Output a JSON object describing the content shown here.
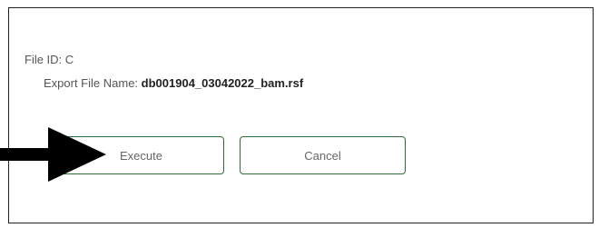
{
  "dialog": {
    "file_id": "File ID: C",
    "export_label": "Export File Name: ",
    "export_value": "db001904_03042022_bam.rsf"
  },
  "buttons": {
    "execute_label": "Execute",
    "cancel_label": "Cancel"
  },
  "annotation": {
    "icon": "pointer-arrow-icon",
    "color": "#000000"
  },
  "colors": {
    "button_border": "#2e6b3a",
    "frame_border": "#222222"
  }
}
